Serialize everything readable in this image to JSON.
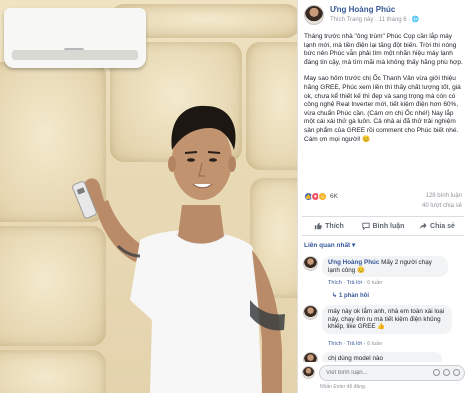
{
  "post": {
    "author": "Ưng Hoàng Phúc",
    "meta": "Thích Trang này · 11 tháng 6 · 🌐",
    "paragraph1": "Tháng trước nhà \"ông trùm\" Phúc Cọp cần lắp máy lạnh mới, mà tiền điện lại tăng đột biến. Trời thì nóng bức nên Phúc vẫn phải tìm một nhãn hiệu máy lạnh đáng tin cậy, mà tìm mãi mà không thấy hãng phù hợp.",
    "paragraph2": "May sao hôm trước chị Ốc Thanh Vân vừa giới thiệu hãng GREE, Phúc xem liền thì thấy chất lượng tốt, giá ok, chưa kể thiết kế thì đẹp và sang trọng mà còn có công nghệ Real Inverter mới, tiết kiệm điện hơn 60%, vừa chuẩn Phúc cần. (Cám ơn chị Ốc nhé!) Nay lắp một cái xài thử gà luôn. Cả nhà ai đã thử trải nghiệm sản phẩm của GREE rồi comment cho Phúc biết nhé. Cám ơn mọi người! 😊"
  },
  "stats": {
    "reactions": "6K",
    "comments": "128 bình luận",
    "shares": "40 lượt chia sẻ"
  },
  "actions": {
    "like": "Thích",
    "comment": "Bình luận",
    "share": "Chia sẻ"
  },
  "sort_label": "Liên quan nhất ▾",
  "comments": [
    {
      "name": "Ưng Hoàng Phúc",
      "text": "Mấy 2 người chạy lạnh công 😊",
      "like": "Thích",
      "reply": "Trả lời",
      "time": "6 tuần",
      "replies": "1 phản hồi"
    },
    {
      "name": "",
      "text": "máy này ok lắm anh, nhà em toàn xài loại này, chạy êm ru mà tiết kiệm điện khủng khiếp, like GREE 👍",
      "like": "Thích",
      "reply": "Trả lời",
      "time": "6 tuần",
      "replies": ""
    },
    {
      "name": "",
      "text": "chị dùng model nào",
      "like": "",
      "reply": "",
      "time": "",
      "replies": ""
    }
  ],
  "composer": {
    "placeholder": "Viết bình luận...",
    "hint": "Nhấn Enter để đăng."
  }
}
